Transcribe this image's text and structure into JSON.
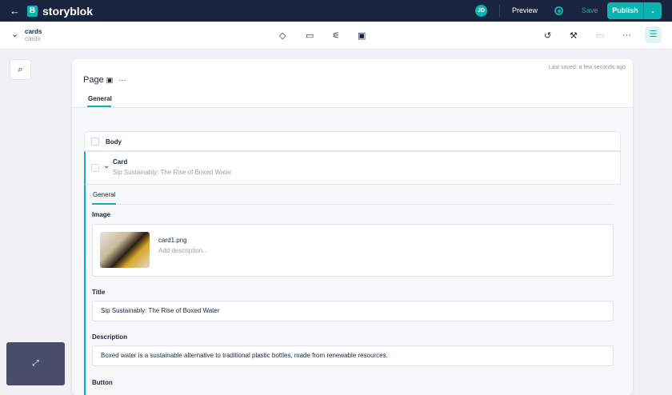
{
  "topbar": {
    "brand": "storyblok",
    "logo_letter": "B",
    "avatar": "JD",
    "preview": "Preview",
    "save": "Save",
    "publish": "Publish"
  },
  "toolbar": {
    "story_name": "cards",
    "story_slug": "cards"
  },
  "editor": {
    "last_saved": "Last saved: a few seconds ago",
    "content_type": "Page",
    "tab": "General",
    "body_label": "Body",
    "block_name": "Card",
    "block_subtitle": "Sip Sustainably: The Rise of Boxed Water",
    "block_tab": "General",
    "image_label": "Image",
    "image_filename": "card1.png",
    "image_desc_placeholder": "Add description...",
    "title_label": "Title",
    "title_value": "Sip Sustainably: The Rise of Boxed Water",
    "description_label": "Description",
    "description_value": "Boxed water is a sustainable alternative to traditional plastic bottles, made from renewable resources.",
    "button_label": "Button"
  }
}
